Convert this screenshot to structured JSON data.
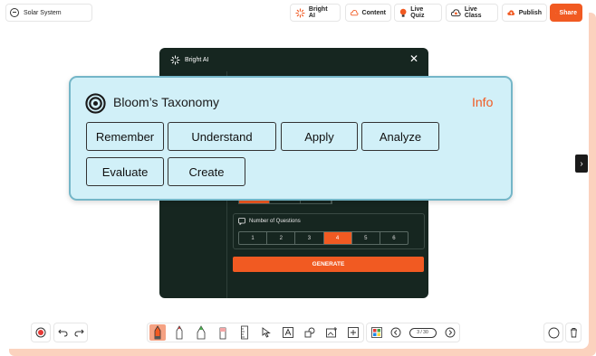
{
  "project": {
    "title": "Solar System"
  },
  "topbar": {
    "bright_ai": "Bright AI",
    "content": "Content",
    "live_quiz": "Live Quiz",
    "live_class": "Live Class",
    "publish": "Publish",
    "share": "Share"
  },
  "modal": {
    "title": "Bright AI",
    "number_of_questions_label": "Number of Questions",
    "question_options": [
      "1",
      "2",
      "3",
      "4",
      "5",
      "6"
    ],
    "selected_option": "4",
    "generate_label": "GENERATE"
  },
  "bloom": {
    "title": "Bloom’s Taxonomy",
    "info": "Info",
    "levels": [
      "Remember",
      "Understand",
      "Apply",
      "Analyze",
      "Evaluate",
      "Create"
    ]
  },
  "bottombar": {
    "page_indicator": "3 / 30"
  },
  "colors": {
    "accent": "#f15a22",
    "bloom_bg": "#d1f0f8",
    "bloom_border": "#74b6c8",
    "modal_bg": "#162620"
  }
}
